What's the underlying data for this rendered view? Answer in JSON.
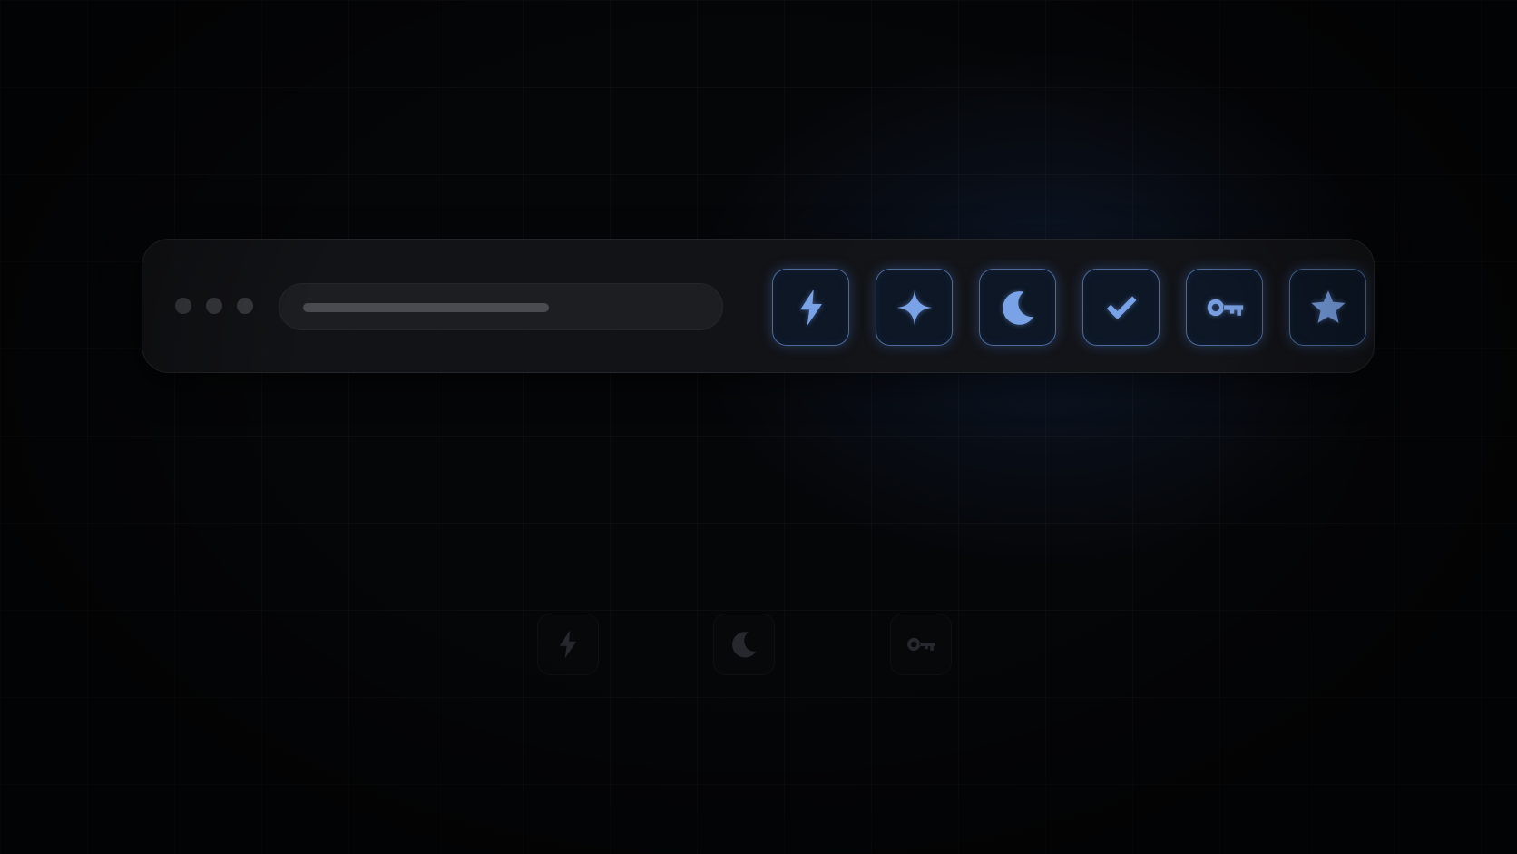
{
  "window": {
    "controls": [
      "dot",
      "dot",
      "dot"
    ],
    "address_bar": {
      "text": "",
      "load_progress": 0.56
    }
  },
  "toolbar": {
    "accent_color": "#7aa2e6",
    "buttons": [
      {
        "icon": "lightning-bolt-icon"
      },
      {
        "icon": "sparkle-icon"
      },
      {
        "icon": "crescent-moon-icon"
      },
      {
        "icon": "checkmark-icon"
      },
      {
        "icon": "key-icon"
      },
      {
        "icon": "star-icon"
      }
    ]
  },
  "reflection": {
    "icons": [
      "lightning-bolt-icon",
      "crescent-moon-icon",
      "key-icon"
    ]
  }
}
